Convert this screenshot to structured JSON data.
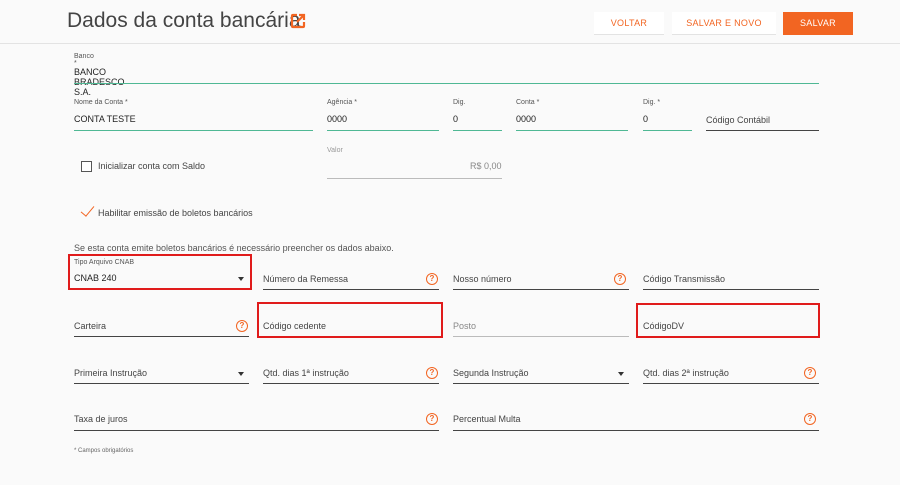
{
  "header": {
    "title": "Dados da conta bancária",
    "external_link_icon": "external-link-icon",
    "buttons": {
      "back": "VOLTAR",
      "save_new": "SALVAR E NOVO",
      "save": "SALVAR"
    }
  },
  "colors": {
    "accent": "#f26522",
    "active_underline": "#4fb894",
    "highlight_box": "#e01b1b"
  },
  "form": {
    "banco": {
      "label": "Banco *",
      "value": "BANCO BRADESCO S.A."
    },
    "nome_conta": {
      "label": "Nome da Conta *",
      "value": "CONTA TESTE"
    },
    "agencia": {
      "label": "Agência *",
      "value": "0000"
    },
    "dig_agencia": {
      "label": "Dig.",
      "value": "0"
    },
    "conta": {
      "label": "Conta *",
      "value": "0000"
    },
    "dig_conta": {
      "label": "Dig. *",
      "value": "0"
    },
    "codigo_contabil": {
      "placeholder": "Código Contábil"
    },
    "inicializar_saldo": {
      "label": "Inicializar conta com Saldo",
      "checked": false
    },
    "valor": {
      "label": "Valor",
      "placeholder": "R$ 0,00"
    },
    "habilitar_boletos": {
      "label": "Habilitar emissão de boletos bancários",
      "checked": true
    },
    "info_text": "Se esta conta emite boletos bancários é necessário preencher os dados abaixo.",
    "tipo_arquivo_cnab": {
      "label": "Tipo Arquivo CNAB",
      "value": "CNAB 240"
    },
    "numero_remessa": {
      "placeholder": "Número da Remessa"
    },
    "nosso_numero": {
      "placeholder": "Nosso número"
    },
    "codigo_transmissao": {
      "placeholder": "Código Transmissão"
    },
    "carteira": {
      "placeholder": "Carteira"
    },
    "codigo_cedente": {
      "placeholder": "Código cedente"
    },
    "posto": {
      "placeholder": "Posto"
    },
    "codigo_dv": {
      "placeholder": "CódigoDV"
    },
    "primeira_instrucao": {
      "placeholder": "Primeira Instrução"
    },
    "qtd_dias_1": {
      "placeholder": "Qtd. dias 1ª instrução"
    },
    "segunda_instrucao": {
      "placeholder": "Segunda Instrução"
    },
    "qtd_dias_2": {
      "placeholder": "Qtd. dias 2ª instrução"
    },
    "taxa_juros": {
      "placeholder": "Taxa de juros"
    },
    "percentual_multa": {
      "placeholder": "Percentual Multa"
    },
    "help_glyph": "?"
  },
  "footnote": "* Campos obrigatórios"
}
